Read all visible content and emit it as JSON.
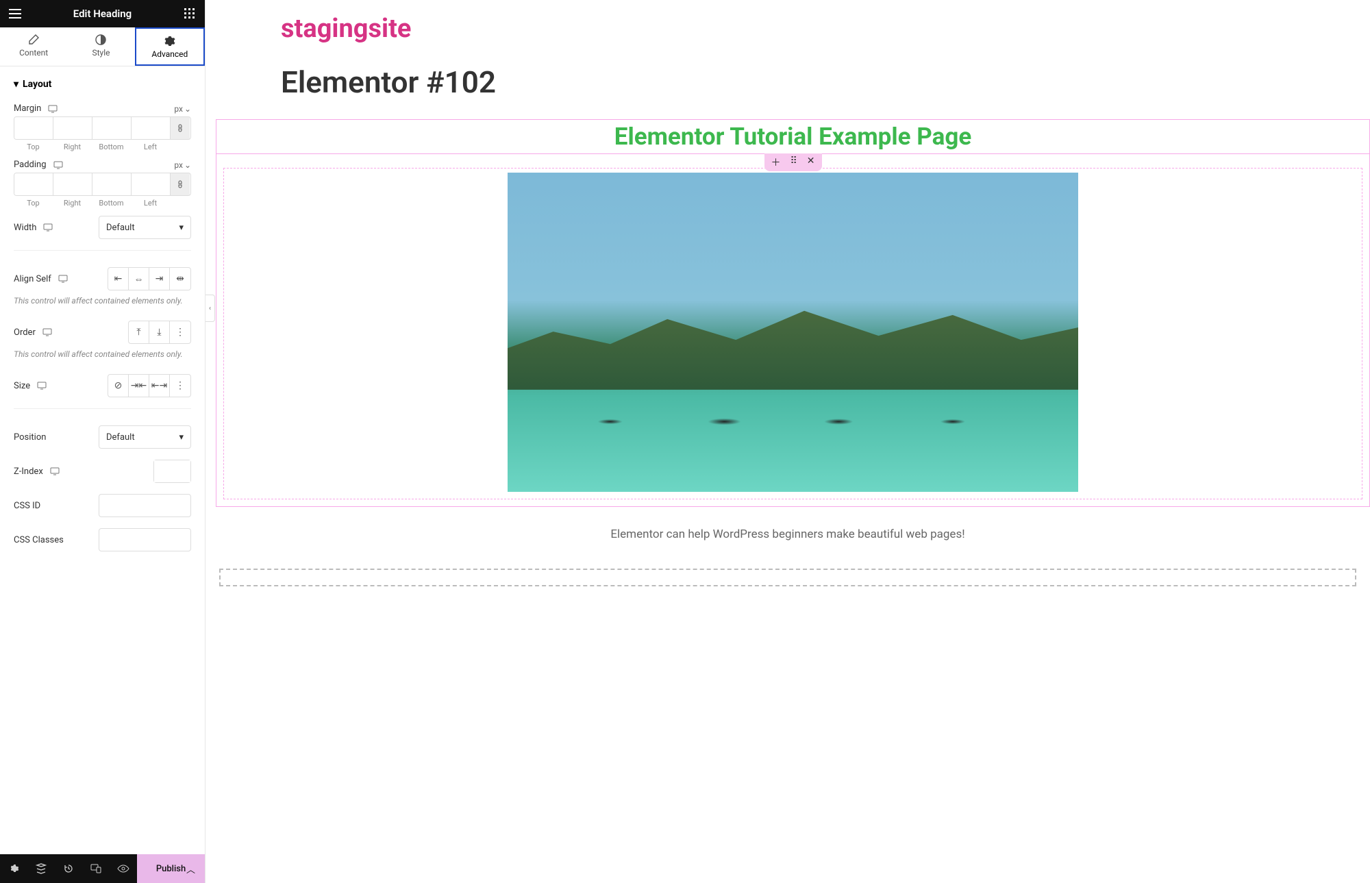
{
  "sidebar": {
    "title": "Edit Heading",
    "tabs": {
      "content": "Content",
      "style": "Style",
      "advanced": "Advanced"
    },
    "sections": {
      "layout": "Layout"
    },
    "controls": {
      "margin": {
        "label": "Margin",
        "unit": "px",
        "sides": [
          "Top",
          "Right",
          "Bottom",
          "Left"
        ]
      },
      "padding": {
        "label": "Padding",
        "unit": "px",
        "sides": [
          "Top",
          "Right",
          "Bottom",
          "Left"
        ]
      },
      "width": {
        "label": "Width",
        "value": "Default"
      },
      "align_self": {
        "label": "Align Self",
        "helper": "This control will affect contained elements only."
      },
      "order": {
        "label": "Order",
        "helper": "This control will affect contained elements only."
      },
      "size": {
        "label": "Size"
      },
      "position": {
        "label": "Position",
        "value": "Default"
      },
      "zindex": {
        "label": "Z-Index"
      },
      "css_id": {
        "label": "CSS ID"
      },
      "css_classes": {
        "label": "CSS Classes"
      }
    },
    "footer": {
      "publish": "Publish"
    }
  },
  "canvas": {
    "site_title": "stagingsite",
    "page_title": "Elementor #102",
    "heading_text": "Elementor Tutorial Example Page",
    "caption": "Elementor can help WordPress beginners make beautiful web pages!"
  }
}
